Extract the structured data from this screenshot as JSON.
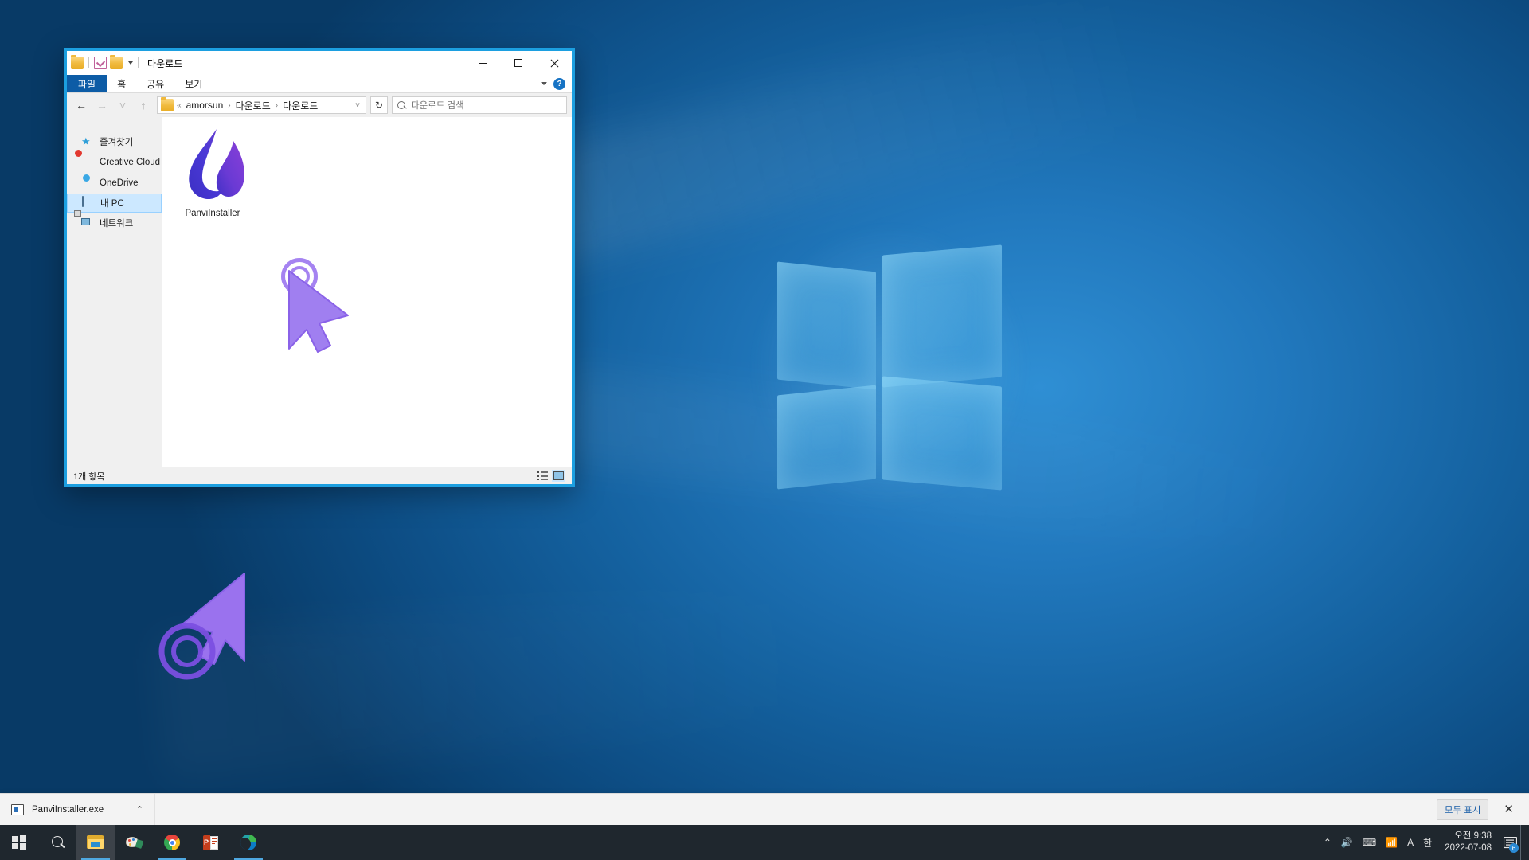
{
  "window": {
    "title": "다운로드",
    "quick_access": [
      "folder-icon",
      "properties-icon",
      "new-folder-icon",
      "dropdown-caret"
    ],
    "controls": {
      "minimize": "–",
      "maximize": "□",
      "close": "✕"
    },
    "ribbon_tabs": [
      {
        "label": "파일",
        "active": true
      },
      {
        "label": "홈",
        "active": false
      },
      {
        "label": "공유",
        "active": false
      },
      {
        "label": "보기",
        "active": false
      }
    ],
    "ribbon_help": "?",
    "nav": {
      "back": "←",
      "forward": "→",
      "recent": "˅",
      "up": "↑"
    },
    "breadcrumb": {
      "prefix": "«",
      "items": [
        "amorsun",
        "다운로드",
        "다운로드"
      ],
      "separator": "›",
      "dropdown": "˅"
    },
    "refresh": "↻",
    "search": {
      "placeholder": "다운로드 검색",
      "value": ""
    },
    "sidebar": [
      {
        "label": "즐겨찾기",
        "icon": "star-icon",
        "selected": false
      },
      {
        "label": "Creative Cloud File",
        "icon": "creative-cloud-icon",
        "selected": false
      },
      {
        "label": "OneDrive",
        "icon": "onedrive-cloud-icon",
        "selected": false
      },
      {
        "label": "내 PC",
        "icon": "this-pc-icon",
        "selected": true
      },
      {
        "label": "네트워크",
        "icon": "network-icon",
        "selected": false
      }
    ],
    "files": [
      {
        "name": "PanviInstaller",
        "icon": "panvi-flame-icon"
      }
    ],
    "status": {
      "item_count": "1개 항목"
    },
    "view_buttons": [
      {
        "name": "details-view",
        "active": false
      },
      {
        "name": "large-icons-view",
        "active": true
      }
    ]
  },
  "download_bar": {
    "item": {
      "filename": "PanviInstaller.exe",
      "caret": "⌃"
    },
    "show_all_label": "모두 표시",
    "close_label": "✕"
  },
  "taskbar": {
    "items": [
      {
        "name": "start-button",
        "icon": "windows-logo-icon"
      },
      {
        "name": "search-button",
        "icon": "search-icon"
      },
      {
        "name": "file-explorer-button",
        "icon": "folder-icon",
        "running": true,
        "active": true
      },
      {
        "name": "paint-3d-button",
        "icon": "paint-palette-icon"
      },
      {
        "name": "chrome-button",
        "icon": "chrome-icon",
        "running": true
      },
      {
        "name": "powerpoint-button",
        "icon": "powerpoint-icon"
      },
      {
        "name": "edge-button",
        "icon": "edge-icon",
        "running": true
      }
    ],
    "tray": {
      "overflow": "⌃",
      "volume": "🔊",
      "keyboard": "⌨",
      "wifi": "📶",
      "ime": "A",
      "ime2": "한",
      "time": "오전 9:38",
      "date": "2022-07-08",
      "notification_count": "6"
    }
  },
  "colors": {
    "window_border": "#1c9fe0",
    "ribbon_file": "#0d5ca6",
    "selection": "#cce8ff",
    "cursor_purple": "#a07ff0",
    "logo_blue": "#3f36c8",
    "logo_purple": "#7b3fd6",
    "taskbar": "#1f272e"
  }
}
